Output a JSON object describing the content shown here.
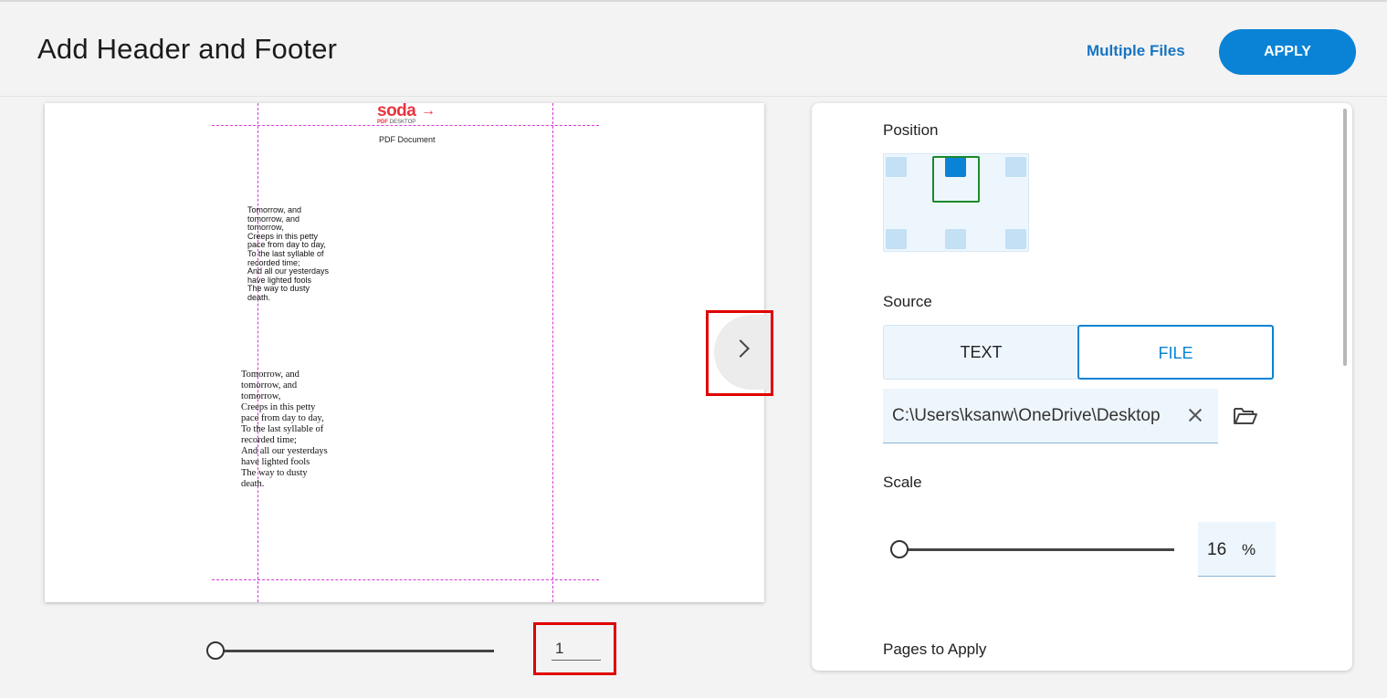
{
  "header": {
    "title": "Add Header and Footer",
    "multiple_files_label": "Multiple Files",
    "apply_label": "APPLY"
  },
  "preview": {
    "logo_text": "soda",
    "logo_sub_brand": "PDF",
    "logo_sub_product": "DESKTOP",
    "header_text": "PDF Document",
    "poem_small": "Tomorrow, and\ntomorrow, and\ntomorrow,\nCreeps in this petty\npace from day to day,\nTo the last syllable of\nrecorded time;\nAnd all our yesterdays\nhave lighted fools\nThe way to dusty\ndeath.",
    "poem_large": "Tomorrow, and\ntomorrow, and\ntomorrow,\nCreeps in this petty\npace from day to day,\nTo the last syllable of\nrecorded time;\nAnd all our yesterdays\nhave lighted fools\nThe way to dusty\ndeath.",
    "page_number": "1",
    "page_slider_fraction": 0
  },
  "settings": {
    "position_label": "Position",
    "position_selected": "top-center",
    "source_label": "Source",
    "source_tabs": [
      "TEXT",
      "FILE"
    ],
    "source_selected": "FILE",
    "file_path": "C:\\Users\\ksanw\\OneDrive\\Desktop",
    "scale_label": "Scale",
    "scale_value": "16",
    "scale_unit": "%",
    "pages_label": "Pages to Apply"
  },
  "colors": {
    "accent": "#0a83d6",
    "link": "#1874c1",
    "highlight": "#e00000",
    "guide": "#d63ad6",
    "logo": "#e8343f"
  }
}
